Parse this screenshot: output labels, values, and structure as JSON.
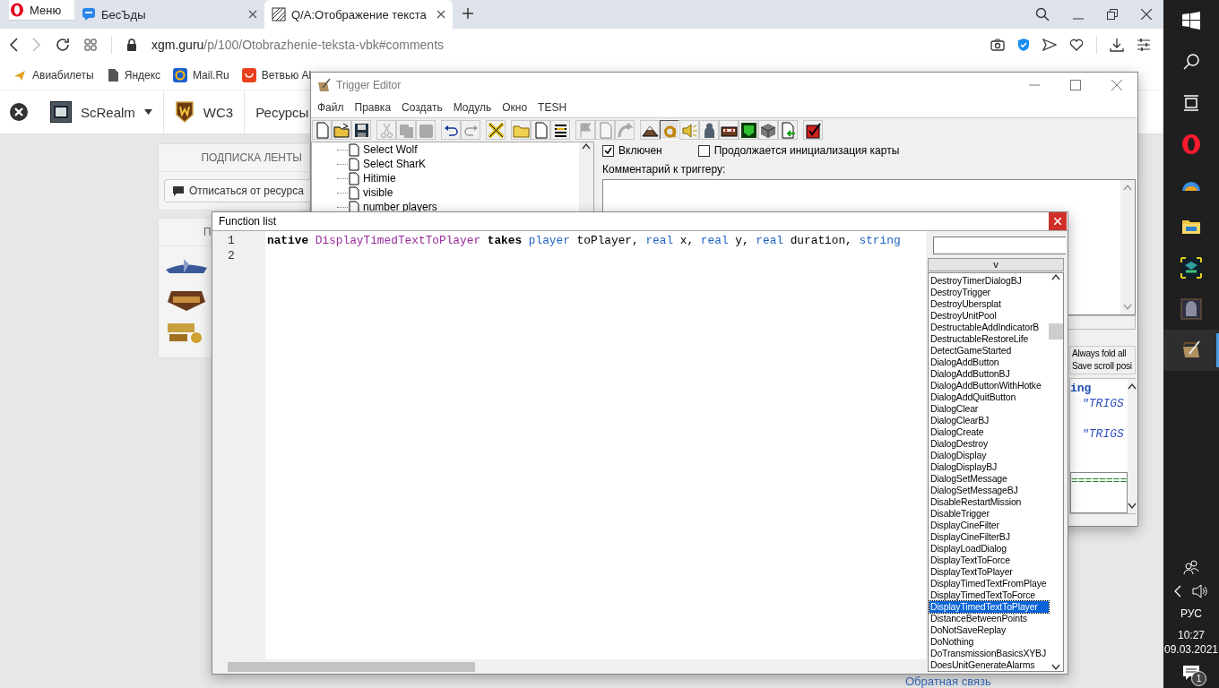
{
  "browser": {
    "tabs": [
      {
        "kind": "menu",
        "label": "Меню",
        "selected": false
      },
      {
        "kind": "chat",
        "label": "БесЪды",
        "selected": false
      },
      {
        "kind": "page",
        "label": "Q/A:Отображение текста",
        "selected": true
      }
    ],
    "address": {
      "host": "xgm.guru",
      "path": "/p/100/Otobrazhenie-teksta-vbk#comments"
    },
    "bookmarks": [
      {
        "kind": "plane",
        "label": "Авиабилеты"
      },
      {
        "kind": "doc",
        "label": "Яндекс"
      },
      {
        "kind": "at",
        "label": "Mail.Ru"
      },
      {
        "kind": "bag",
        "label": "Ветвью Al"
      }
    ]
  },
  "site": {
    "nav": [
      {
        "kind": "logo",
        "label": "ScRealm",
        "dropdown": true
      },
      {
        "kind": "shield",
        "label": "WC3",
        "dropdown": false
      },
      {
        "kind": "text",
        "label": "Ресурсы",
        "dropdown": false
      }
    ],
    "subscription": {
      "title": "ПОДПИСКА ЛЕНТЫ",
      "button": "Отписаться от ресурса"
    },
    "partners": {
      "title": "П"
    },
    "footer_link": "Обратная связь"
  },
  "trigger_editor": {
    "title": "Trigger Editor",
    "menu": [
      "Файл",
      "Правка",
      "Создать",
      "Модуль",
      "Окно",
      "TESH"
    ],
    "toolbar": [
      [
        {
          "kind": "new",
          "disabled": false,
          "pressed": false
        },
        {
          "kind": "open",
          "disabled": false,
          "pressed": false
        },
        {
          "kind": "save",
          "disabled": false,
          "pressed": false
        }
      ],
      [
        {
          "kind": "cut",
          "disabled": true,
          "pressed": false
        },
        {
          "kind": "copy",
          "disabled": true,
          "pressed": false
        },
        {
          "kind": "paste",
          "disabled": true,
          "pressed": false
        }
      ],
      [
        {
          "kind": "undo",
          "disabled": false,
          "pressed": false
        },
        {
          "kind": "redo",
          "disabled": true,
          "pressed": false
        }
      ],
      [
        {
          "kind": "x",
          "disabled": false,
          "pressed": false
        }
      ],
      [
        {
          "kind": "folder",
          "disabled": false,
          "pressed": false
        },
        {
          "kind": "new",
          "disabled": false,
          "pressed": false
        },
        {
          "kind": "list",
          "disabled": false,
          "pressed": false
        }
      ],
      [
        {
          "kind": "flag",
          "disabled": true,
          "pressed": false
        },
        {
          "kind": "new",
          "disabled": true,
          "pressed": false
        },
        {
          "kind": "arrow",
          "disabled": true,
          "pressed": false
        }
      ],
      [
        {
          "kind": "terrain",
          "disabled": false,
          "pressed": false
        },
        {
          "kind": "ring",
          "disabled": false,
          "pressed": true
        },
        {
          "kind": "sound",
          "disabled": false,
          "pressed": false
        },
        {
          "kind": "figure",
          "disabled": false,
          "pressed": false
        },
        {
          "kind": "chest",
          "disabled": false,
          "pressed": false
        },
        {
          "kind": "mask",
          "disabled": false,
          "pressed": false
        },
        {
          "kind": "cube",
          "disabled": false,
          "pressed": false
        },
        {
          "kind": "import",
          "disabled": false,
          "pressed": false
        }
      ],
      [
        {
          "kind": "check",
          "disabled": false,
          "pressed": false
        }
      ]
    ],
    "tree": [
      {
        "label": "Select Wolf"
      },
      {
        "label": "Select SharK"
      },
      {
        "label": "Hitimie"
      },
      {
        "label": "visible"
      },
      {
        "label": "number players"
      }
    ],
    "enabled": {
      "label": "Включен",
      "checked": true
    },
    "initialization": {
      "label": "Продолжается инициализация карты",
      "checked": false
    },
    "comment_label": "Комментарий к триггеру:",
    "options": [
      {
        "label": "Always fold all"
      },
      {
        "label": "Save scroll posi"
      }
    ],
    "code_fragments": [
      {
        "text": "ing",
        "kind": "keyword"
      },
      {
        "text": "\"TRIGS",
        "kind": "string"
      },
      {
        "text": "\"TRIGS",
        "kind": "string"
      },
      {
        "text": "========",
        "kind": "comment"
      }
    ]
  },
  "function_list": {
    "title": "Function list",
    "lines": [
      {
        "number": "1",
        "tokens": [
          {
            "text": "native",
            "kind": "keyword"
          },
          {
            "text": " DisplayTimedTextToPlayer ",
            "kind": "function"
          },
          {
            "text": "takes",
            "kind": "keyword"
          },
          {
            "text": " player",
            "kind": "type"
          },
          {
            "text": " toPlayer, ",
            "kind": "plain"
          },
          {
            "text": "real",
            "kind": "type"
          },
          {
            "text": " x, ",
            "kind": "plain"
          },
          {
            "text": "real",
            "kind": "type"
          },
          {
            "text": " y, ",
            "kind": "plain"
          },
          {
            "text": "real",
            "kind": "type"
          },
          {
            "text": " duration, ",
            "kind": "plain"
          },
          {
            "text": "string",
            "kind": "type"
          }
        ]
      },
      {
        "number": "2"
      }
    ],
    "expand_button": "v",
    "functions": [
      {
        "name": "DestroyTimerDialogBJ",
        "selected": false
      },
      {
        "name": "DestroyTrigger",
        "selected": false
      },
      {
        "name": "DestroyUbersplat",
        "selected": false
      },
      {
        "name": "DestroyUnitPool",
        "selected": false
      },
      {
        "name": "DestructableAddIndicatorB",
        "selected": false
      },
      {
        "name": "DestructableRestoreLife",
        "selected": false
      },
      {
        "name": "DetectGameStarted",
        "selected": false
      },
      {
        "name": "DialogAddButton",
        "selected": false
      },
      {
        "name": "DialogAddButtonBJ",
        "selected": false
      },
      {
        "name": "DialogAddButtonWithHotke",
        "selected": false
      },
      {
        "name": "DialogAddQuitButton",
        "selected": false
      },
      {
        "name": "DialogClear",
        "selected": false
      },
      {
        "name": "DialogClearBJ",
        "selected": false
      },
      {
        "name": "DialogCreate",
        "selected": false
      },
      {
        "name": "DialogDestroy",
        "selected": false
      },
      {
        "name": "DialogDisplay",
        "selected": false
      },
      {
        "name": "DialogDisplayBJ",
        "selected": false
      },
      {
        "name": "DialogSetMessage",
        "selected": false
      },
      {
        "name": "DialogSetMessageBJ",
        "selected": false
      },
      {
        "name": "DisableRestartMission",
        "selected": false
      },
      {
        "name": "DisableTrigger",
        "selected": false
      },
      {
        "name": "DisplayCineFilter",
        "selected": false
      },
      {
        "name": "DisplayCineFilterBJ",
        "selected": false
      },
      {
        "name": "DisplayLoadDialog",
        "selected": false
      },
      {
        "name": "DisplayTextToForce",
        "selected": false
      },
      {
        "name": "DisplayTextToPlayer",
        "selected": false
      },
      {
        "name": "DisplayTimedTextFromPlaye",
        "selected": false
      },
      {
        "name": "DisplayTimedTextToForce",
        "selected": false
      },
      {
        "name": "DisplayTimedTextToPlayer",
        "selected": true
      },
      {
        "name": "DistanceBetweenPoints",
        "selected": false
      },
      {
        "name": "DoNotSaveReplay",
        "selected": false
      },
      {
        "name": "DoNothing",
        "selected": false
      },
      {
        "name": "DoTransmissionBasicsXYBJ",
        "selected": false
      },
      {
        "name": "DoesUnitGenerateAlarms",
        "selected": false
      }
    ]
  },
  "taskbar": {
    "apps": [
      {
        "kind": "opera",
        "active": false
      },
      {
        "kind": "dome",
        "active": false
      },
      {
        "kind": "folder",
        "active": false
      },
      {
        "kind": "emblem",
        "active": false
      },
      {
        "kind": "helmet",
        "active": false
      },
      {
        "kind": "scroll",
        "active": true
      }
    ],
    "language": "РУС",
    "time": "10:27",
    "date": "09.03.2021",
    "notifications": "1"
  }
}
